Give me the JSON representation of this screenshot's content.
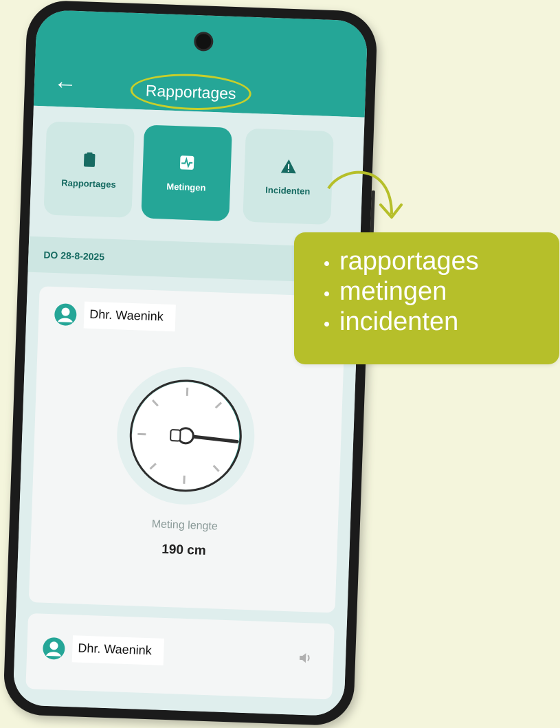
{
  "appbar": {
    "title": "Rapportages"
  },
  "tiles": [
    {
      "label": "Rapportages",
      "icon": "clipboard-icon",
      "active": false
    },
    {
      "label": "Metingen",
      "icon": "heart-monitor-icon",
      "active": true
    },
    {
      "label": "Incidenten",
      "icon": "warning-icon",
      "active": false
    }
  ],
  "date_header": "DO 28-8-2025",
  "report_card": {
    "name": "Dhr. Waenink",
    "measurement_label": "Meting lengte",
    "measurement_value": "190 cm"
  },
  "report_card_2": {
    "name": "Dhr. Waenink",
    "icon": "speaker-icon"
  },
  "callout": {
    "items": [
      "rapportages",
      "metingen",
      "incidenten"
    ]
  },
  "colors": {
    "teal": "#25a697",
    "dark_teal": "#176b62",
    "lime": "#b6bf2a",
    "background": "#f4f5dc"
  }
}
